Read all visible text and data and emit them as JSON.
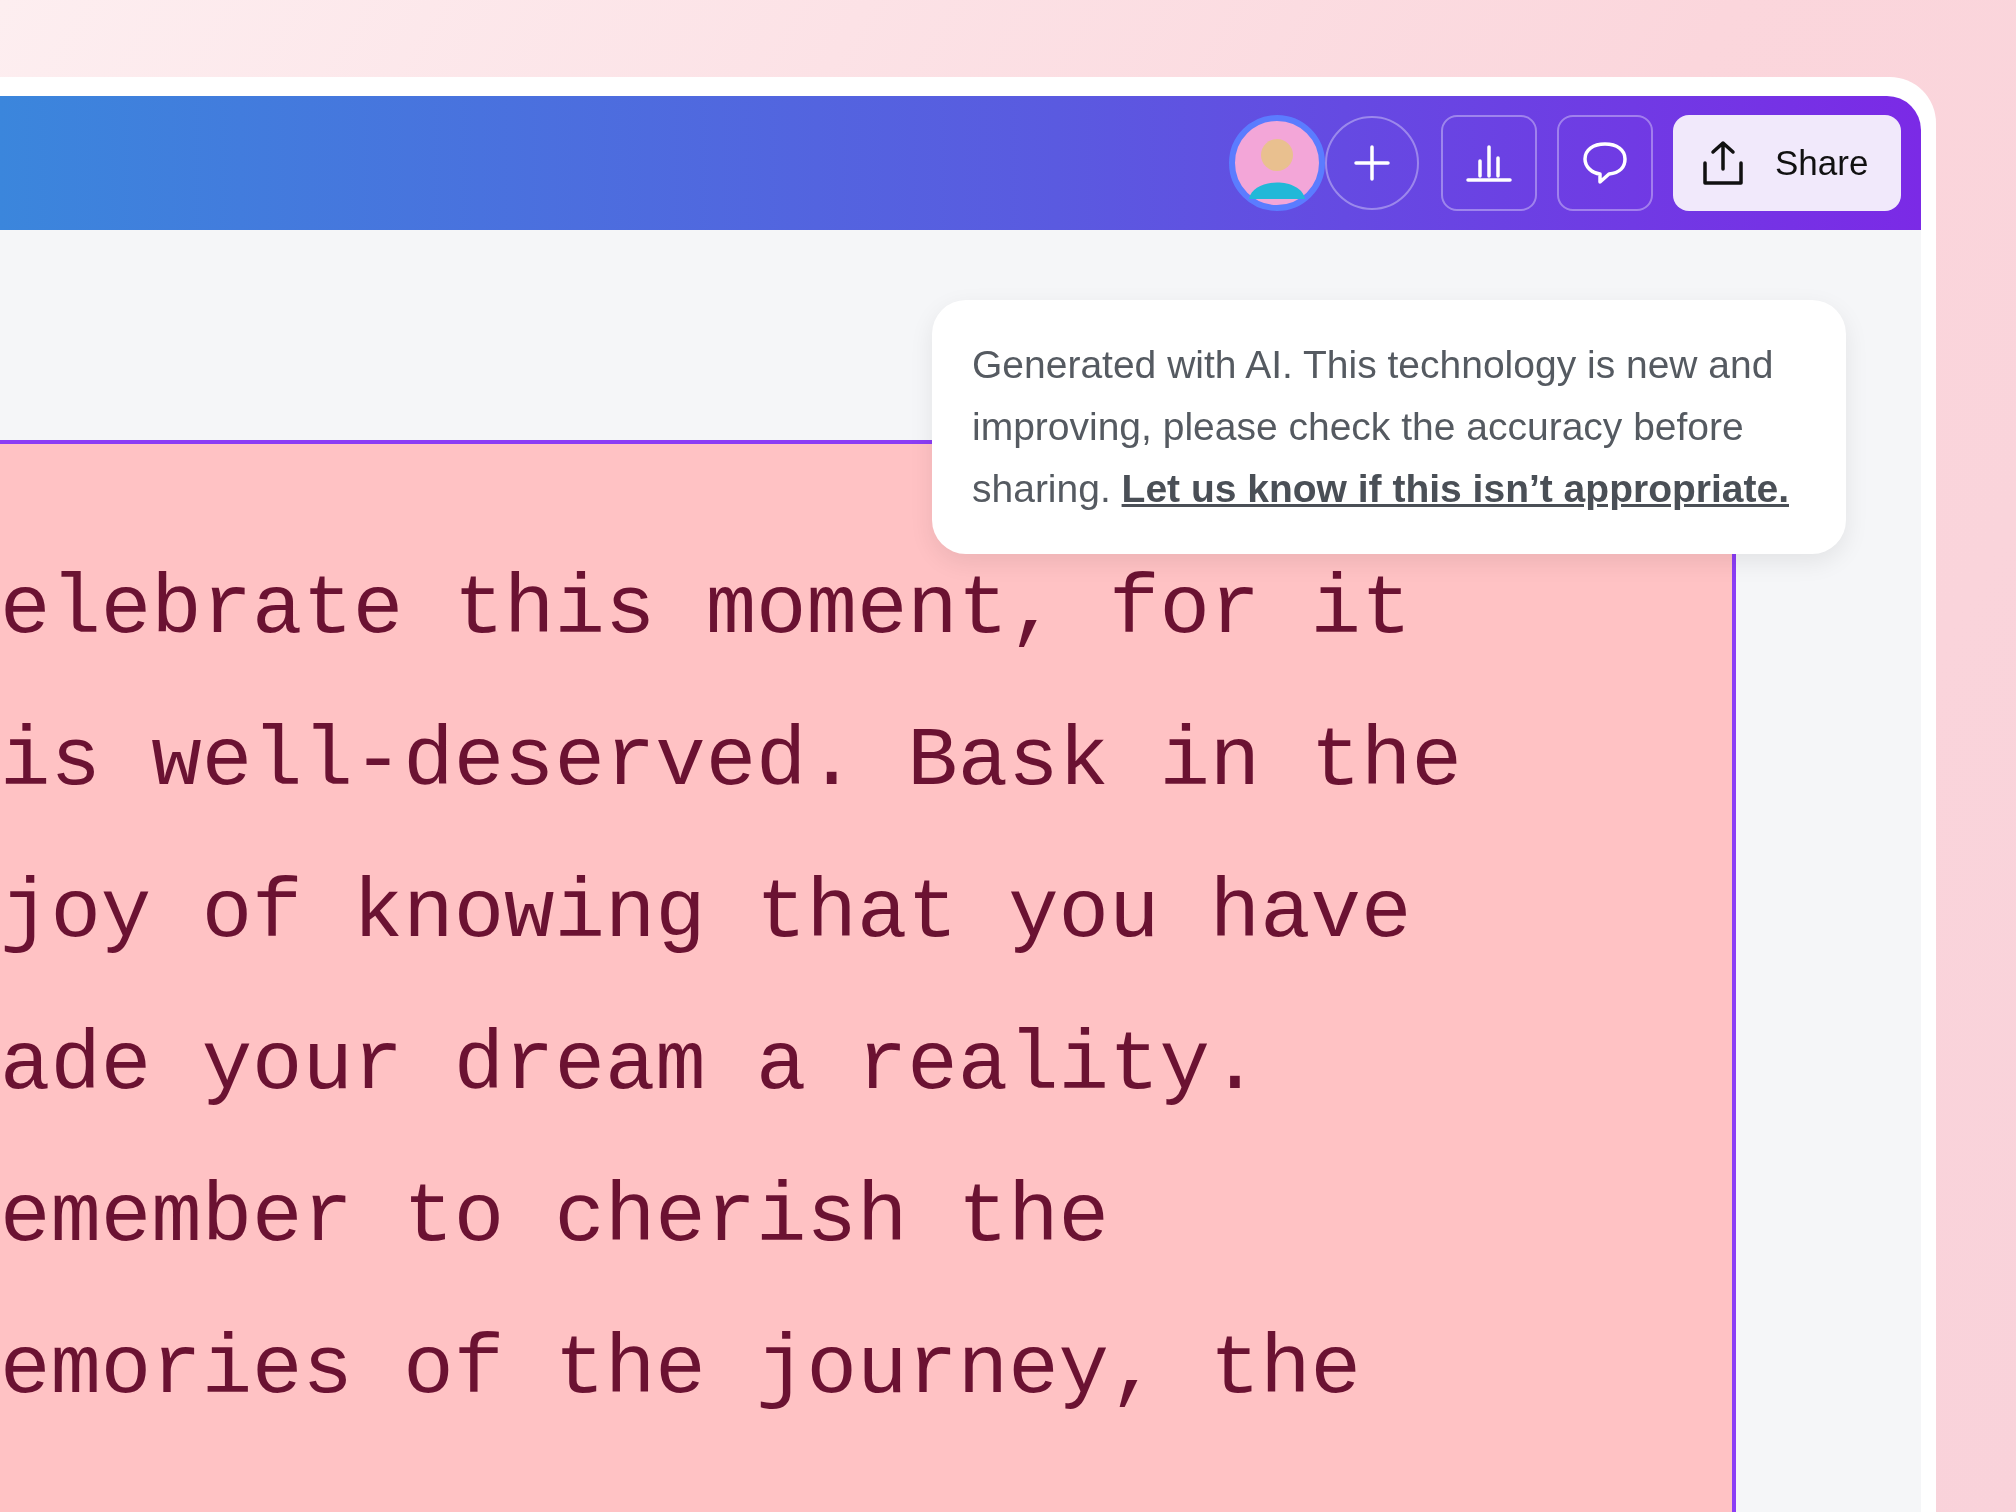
{
  "header": {
    "share_button": {
      "label": "Share"
    }
  },
  "notice": {
    "text": "Generated with AI. This technology is new and improving, please check the accuracy before sharing.",
    "link": "Let us know if this isn’t appropriate."
  },
  "design": {
    "lines": [
      "elebrate this moment, for it",
      "is well-deserved. Bask in the",
      "joy of knowing that you have",
      "ade your dream a reality.",
      "emember to cherish the",
      "emories of the journey, the"
    ]
  }
}
